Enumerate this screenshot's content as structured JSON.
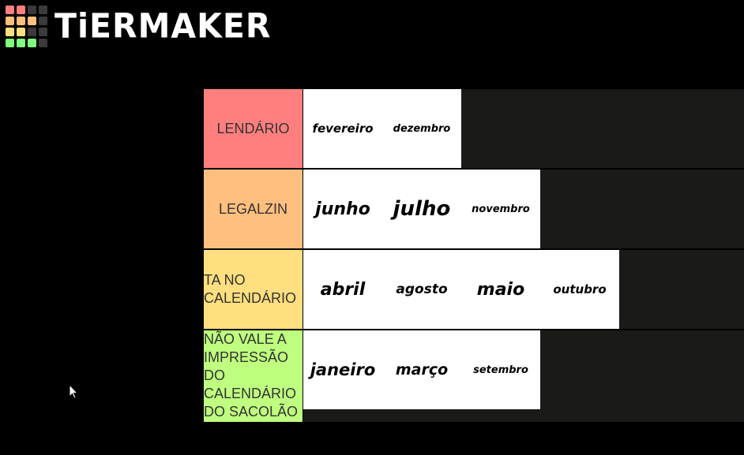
{
  "brand": {
    "name": "TiERMAKER",
    "grid_colors": [
      "#ff7f7f",
      "#ff7f7f",
      "#3a3a3a",
      "#3a3a3a",
      "#ffbf7f",
      "#ffbf7f",
      "#ffbf7f",
      "#3a3a3a",
      "#ffdf7f",
      "#ffdf7f",
      "#3a3a3a",
      "#3a3a3a",
      "#7fff7f",
      "#7fff7f",
      "#7fff7f",
      "#3a3a3a"
    ]
  },
  "tiers": [
    {
      "label": "LENDÁRIO",
      "color": "#ff7f7f",
      "items": [
        "fevereiro",
        "dezembro"
      ]
    },
    {
      "label": "LEGALZIN",
      "color": "#ffbf7f",
      "items": [
        "junho",
        "julho",
        "novembro"
      ]
    },
    {
      "label": "TA NO CALENDÁRIO",
      "color": "#ffdf7f",
      "items": [
        "abril",
        "agosto",
        "maio",
        "outubro"
      ]
    },
    {
      "label": "NÃO VALE A IMPRESSÃO DO CALENDÁRIO DO SACOLÃO",
      "color": "#bfff7f",
      "items": [
        "janeiro",
        "março",
        "setembro"
      ]
    }
  ]
}
